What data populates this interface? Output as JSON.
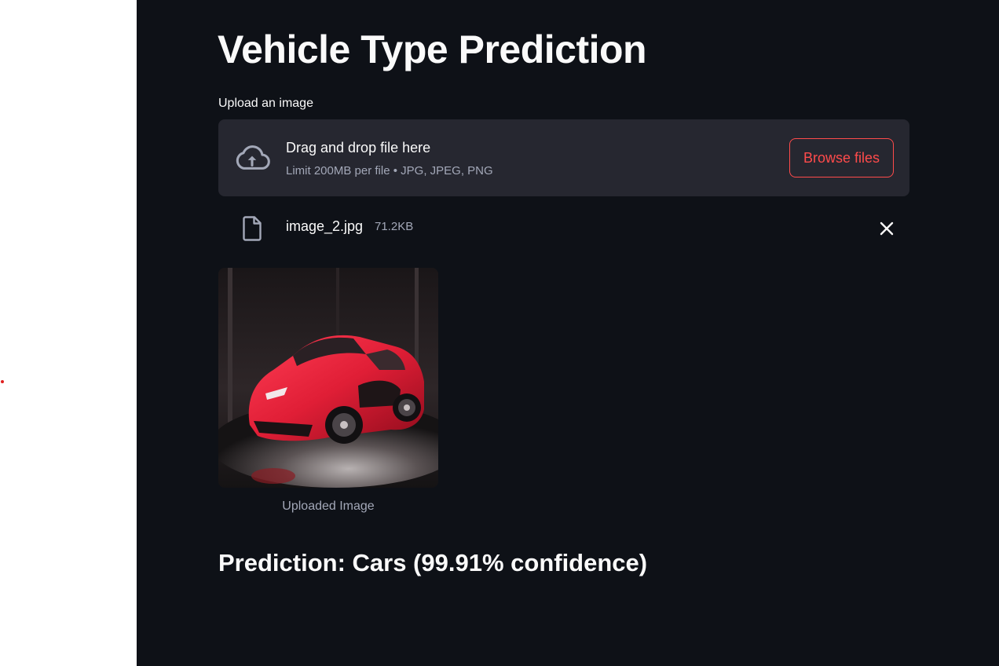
{
  "colors": {
    "sidebar_bg": "#ffffff",
    "main_bg": "#0e1117",
    "dropzone_bg": "#262730",
    "accent": "#ff4b4b",
    "muted_text": "#a3a8b8",
    "dot": "#e02020"
  },
  "app": {
    "title": "Vehicle Type Prediction"
  },
  "uploader": {
    "label": "Upload an image",
    "drag_text": "Drag and drop file here",
    "limit_text": "Limit 200MB per file • JPG, JPEG, PNG",
    "browse_label": "Browse files",
    "icon": "cloud-upload-icon"
  },
  "uploaded_file": {
    "name": "image_2.jpg",
    "size": "71.2KB",
    "icon": "file-icon",
    "remove_icon": "close-icon"
  },
  "image": {
    "caption": "Uploaded Image",
    "subject": "red sports car"
  },
  "result": {
    "prediction": "Prediction: Cars (99.91% confidence)"
  }
}
